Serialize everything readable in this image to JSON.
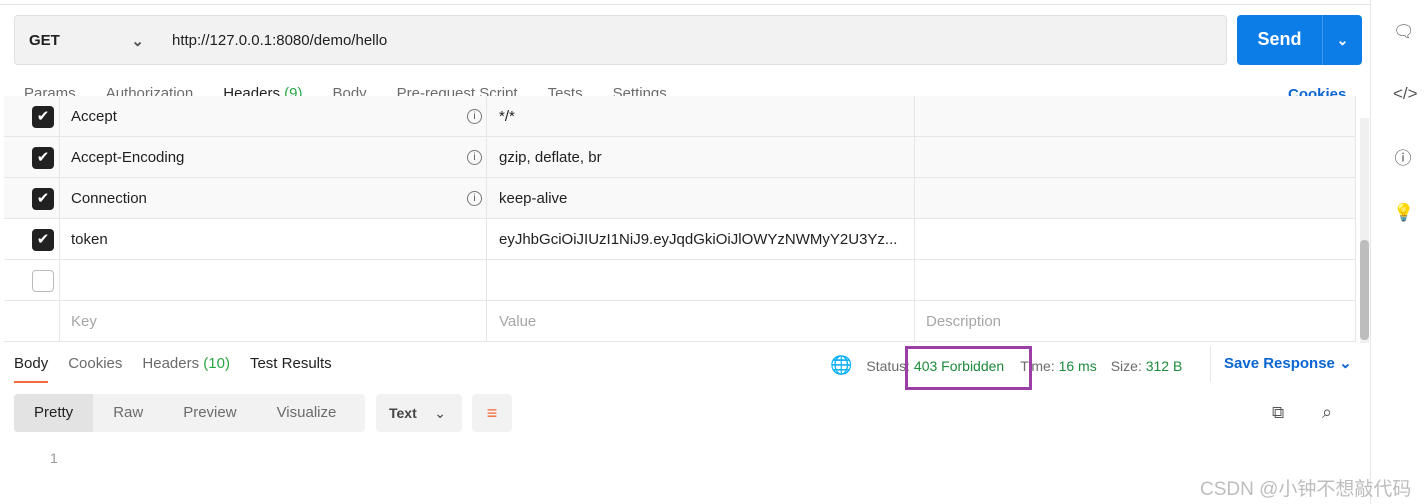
{
  "request": {
    "method": "GET",
    "url": "http://127.0.0.1:8080/demo/hello",
    "send_label": "Send"
  },
  "tabs": [
    {
      "label": "Params"
    },
    {
      "label": "Authorization"
    },
    {
      "label": "Headers",
      "count": "(9)"
    },
    {
      "label": "Body"
    },
    {
      "label": "Pre-request Script"
    },
    {
      "label": "Tests"
    },
    {
      "label": "Settings"
    }
  ],
  "cookies_label": "Cookies",
  "headers": [
    {
      "key": "Accept",
      "value": "*/*",
      "checked": true,
      "info": true
    },
    {
      "key": "Accept-Encoding",
      "value": "gzip, deflate, br",
      "checked": true,
      "info": true
    },
    {
      "key": "Connection",
      "value": "keep-alive",
      "checked": true,
      "info": true
    },
    {
      "key": "token",
      "value": "eyJhbGciOiJIUzI1NiJ9.eyJqdGkiOiJlOWYzNWMyY2U3Yz...",
      "checked": true,
      "info": false
    }
  ],
  "placeholders": {
    "key": "Key",
    "value": "Value",
    "description": "Description"
  },
  "response": {
    "tabs": [
      {
        "label": "Body"
      },
      {
        "label": "Cookies"
      },
      {
        "label": "Headers",
        "count": "(10)"
      },
      {
        "label": "Test Results"
      }
    ],
    "status_label": "Status:",
    "status": "403 Forbidden",
    "time_label": "Time:",
    "time": "16 ms",
    "size_label": "Size:",
    "size": "312 B",
    "save_label": "Save Response",
    "views": [
      "Pretty",
      "Raw",
      "Preview",
      "Visualize"
    ],
    "format": "Text",
    "line": "1"
  },
  "highlight_color": "#9b3fa6",
  "watermark": "CSDN @小钟不想敲代码"
}
